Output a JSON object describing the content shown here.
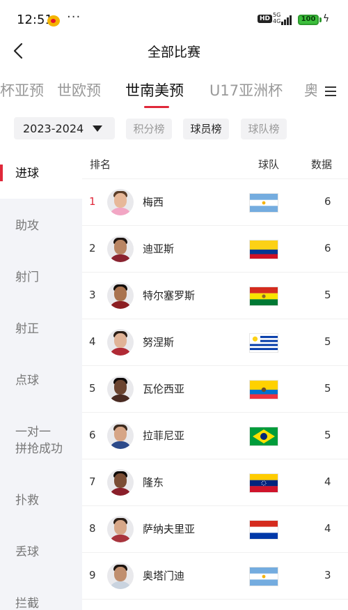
{
  "status": {
    "time": "12:51",
    "dots": "···",
    "hd": "HD",
    "net": "5G",
    "net_sub": "4G",
    "battery": "100"
  },
  "header": {
    "title": "全部比赛"
  },
  "tabs": [
    {
      "label": "亚洲杯亚预"
    },
    {
      "label": "世欧预"
    },
    {
      "label": "世南美预"
    },
    {
      "label": "U17亚洲杯"
    },
    {
      "label": "奥"
    }
  ],
  "filters": {
    "season": "2023-2024",
    "chips": [
      {
        "label": "积分榜"
      },
      {
        "label": "球员榜"
      },
      {
        "label": "球队榜"
      }
    ]
  },
  "sidebar": {
    "items": [
      {
        "label": "进球"
      },
      {
        "label": "助攻"
      },
      {
        "label": "射门"
      },
      {
        "label": "射正"
      },
      {
        "label": "点球"
      },
      {
        "label": "一对一"
      },
      {
        "label": "拼抢成功"
      },
      {
        "label": "扑救"
      },
      {
        "label": "丢球"
      },
      {
        "label": "拦截"
      }
    ]
  },
  "table": {
    "headers": {
      "rank": "排名",
      "team": "球队",
      "data": "数据"
    },
    "rows": [
      {
        "rank": "1",
        "name": "梅西",
        "team_flag": "argentina-flag-icon",
        "value": "6"
      },
      {
        "rank": "2",
        "name": "迪亚斯",
        "team_flag": "colombia-flag-icon",
        "value": "6"
      },
      {
        "rank": "3",
        "name": "特尔塞罗斯",
        "team_flag": "bolivia-flag-icon",
        "value": "5"
      },
      {
        "rank": "4",
        "name": "努涅斯",
        "team_flag": "uruguay-flag-icon",
        "value": "5"
      },
      {
        "rank": "5",
        "name": "瓦伦西亚",
        "team_flag": "ecuador-flag-icon",
        "value": "5"
      },
      {
        "rank": "6",
        "name": "拉菲尼亚",
        "team_flag": "brazil-flag-icon",
        "value": "5"
      },
      {
        "rank": "7",
        "name": "隆东",
        "team_flag": "venezuela-flag-icon",
        "value": "4"
      },
      {
        "rank": "8",
        "name": "萨纳夫里亚",
        "team_flag": "paraguay-flag-icon",
        "value": "4"
      },
      {
        "rank": "9",
        "name": "奥塔门迪",
        "team_flag": "argentina-flag-icon",
        "value": "3"
      }
    ]
  },
  "colors": {
    "accent": "#e0283a",
    "sidebar_bg": "#f3f4f8"
  }
}
